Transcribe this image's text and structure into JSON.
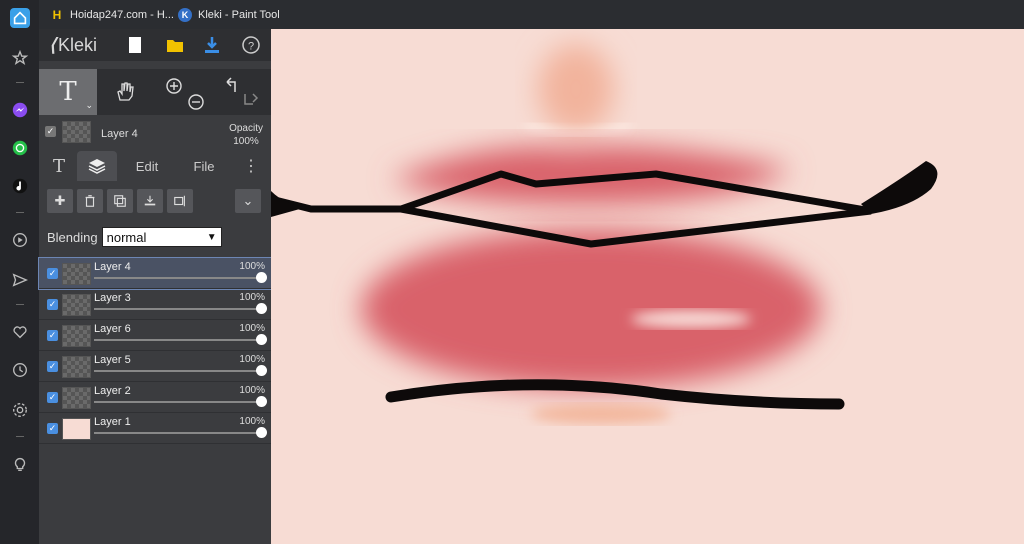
{
  "browser": {
    "tabs": [
      {
        "title": "Hoidap247.com - H...",
        "favicon": "H"
      },
      {
        "title": "Kleki - Paint Tool",
        "favicon": "K"
      }
    ]
  },
  "sidebar": {
    "icons": [
      "home-icon",
      "star-icon",
      "messenger-icon",
      "whatsapp-icon",
      "tiktok-icon",
      "play-icon",
      "send-icon",
      "heart-icon",
      "history-icon",
      "settings-icon",
      "lightbulb-icon"
    ]
  },
  "app": {
    "logo": "Kleki",
    "current_layer": {
      "name": "Layer 4",
      "opacity_label": "Opacity",
      "opacity_value": "100%"
    },
    "tabs": {
      "edit": "Edit",
      "file": "File"
    },
    "blending_label": "Blending",
    "blending_value": "normal",
    "layers": [
      {
        "name": "Layer 4",
        "opacity": "100%",
        "selected": true
      },
      {
        "name": "Layer 3",
        "opacity": "100%",
        "selected": false
      },
      {
        "name": "Layer 6",
        "opacity": "100%",
        "selected": false
      },
      {
        "name": "Layer 5",
        "opacity": "100%",
        "selected": false
      },
      {
        "name": "Layer 2",
        "opacity": "100%",
        "selected": false
      },
      {
        "name": "Layer 1",
        "opacity": "100%",
        "selected": false
      }
    ],
    "colors": {
      "canvas_bg": "#f7dcd4",
      "lip": "#d9626b",
      "line": "#0d0a0a",
      "accent": "#4a8fe0"
    }
  }
}
